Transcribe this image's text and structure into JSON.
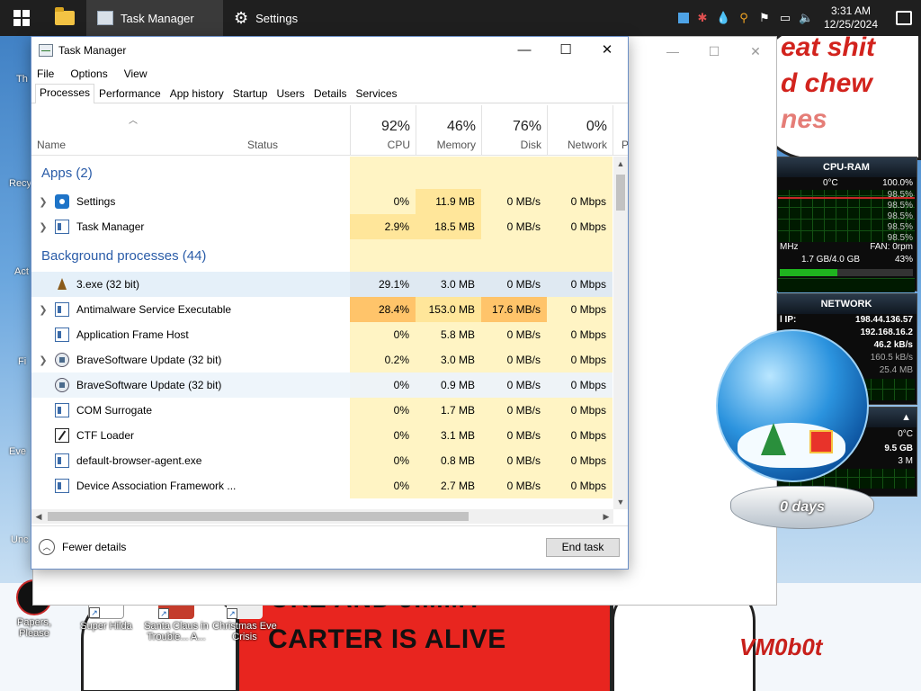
{
  "taskbar": {
    "apps": [
      {
        "label": "Task Manager",
        "active": true
      },
      {
        "label": "Settings",
        "active": false
      }
    ],
    "clock": {
      "time": "3:31 AM",
      "date": "12/25/2024"
    }
  },
  "desktop": {
    "icons": [
      {
        "label": "Papers, Please"
      },
      {
        "label": "Super Hilda"
      },
      {
        "label": "Santa Claus in Trouble... A..."
      },
      {
        "label": "Christmas Eve Crisis"
      }
    ],
    "edge_labels": [
      "Th",
      "Recy",
      "Act",
      "Fi",
      "Eve",
      "Unc"
    ],
    "speech_lines": [
      "eat shit",
      "d chew",
      "nes"
    ],
    "sign_top": "ORE AND JIMMY",
    "sign_main": "CARTER IS ALIVE",
    "signature": "VM0b0t"
  },
  "gadgets": {
    "cpu_ram": {
      "title": "CPU-RAM",
      "temp": "0°C",
      "total": "100.0%",
      "cores": [
        "98.5%",
        "98.5%",
        "98.5%",
        "98.5%",
        "98.5%"
      ],
      "mhz_label": "MHz",
      "fan": "FAN: 0rpm",
      "memory": "1.7 GB/4.0 GB",
      "memory_pct": "43%"
    },
    "network": {
      "title": "NETWORK",
      "ip_label": "l IP:",
      "ip_external": "198.44.136.57",
      "ip_local": "192.168.16.2",
      "down": "46.2 kB/s",
      "up": "160.5 kB/s",
      "total": "25.4 MB"
    },
    "drive": {
      "temp": "0°C",
      "size": "9.5 GB",
      "used": "3 M"
    },
    "snow_globe_label": "0 days"
  },
  "task_manager": {
    "title": "Task Manager",
    "menu": [
      "File",
      "Options",
      "View"
    ],
    "tabs": [
      "Processes",
      "Performance",
      "App history",
      "Startup",
      "Users",
      "Details",
      "Services"
    ],
    "header": {
      "name": "Name",
      "status": "Status",
      "cpu_pct": "92%",
      "cpu": "CPU",
      "mem_pct": "46%",
      "mem": "Memory",
      "disk_pct": "76%",
      "disk": "Disk",
      "net_pct": "0%",
      "net": "Network",
      "power": "P"
    },
    "groups": {
      "apps": "Apps (2)",
      "background": "Background processes (44)"
    },
    "apps": [
      {
        "name": "Settings",
        "cpu": "0%",
        "mem": "11.9 MB",
        "disk": "0 MB/s",
        "net": "0 Mbps"
      },
      {
        "name": "Task Manager",
        "cpu": "2.9%",
        "mem": "18.5 MB",
        "disk": "0 MB/s",
        "net": "0 Mbps"
      }
    ],
    "background": [
      {
        "name": "3.exe (32 bit)",
        "cpu": "29.1%",
        "mem": "3.0 MB",
        "disk": "0 MB/s",
        "net": "0 Mbps"
      },
      {
        "name": "Antimalware Service Executable",
        "cpu": "28.4%",
        "mem": "153.0 MB",
        "disk": "17.6 MB/s",
        "net": "0 Mbps"
      },
      {
        "name": "Application Frame Host",
        "cpu": "0%",
        "mem": "5.8 MB",
        "disk": "0 MB/s",
        "net": "0 Mbps"
      },
      {
        "name": "BraveSoftware Update (32 bit)",
        "cpu": "0.2%",
        "mem": "3.0 MB",
        "disk": "0 MB/s",
        "net": "0 Mbps"
      },
      {
        "name": "BraveSoftware Update (32 bit)",
        "cpu": "0%",
        "mem": "0.9 MB",
        "disk": "0 MB/s",
        "net": "0 Mbps"
      },
      {
        "name": "COM Surrogate",
        "cpu": "0%",
        "mem": "1.7 MB",
        "disk": "0 MB/s",
        "net": "0 Mbps"
      },
      {
        "name": "CTF Loader",
        "cpu": "0%",
        "mem": "3.1 MB",
        "disk": "0 MB/s",
        "net": "0 Mbps"
      },
      {
        "name": "default-browser-agent.exe",
        "cpu": "0%",
        "mem": "0.8 MB",
        "disk": "0 MB/s",
        "net": "0 Mbps"
      },
      {
        "name": "Device Association Framework ...",
        "cpu": "0%",
        "mem": "2.7 MB",
        "disk": "0 MB/s",
        "net": "0 Mbps"
      }
    ],
    "footer": {
      "fewer_details": "Fewer details",
      "end_task": "End task"
    }
  }
}
